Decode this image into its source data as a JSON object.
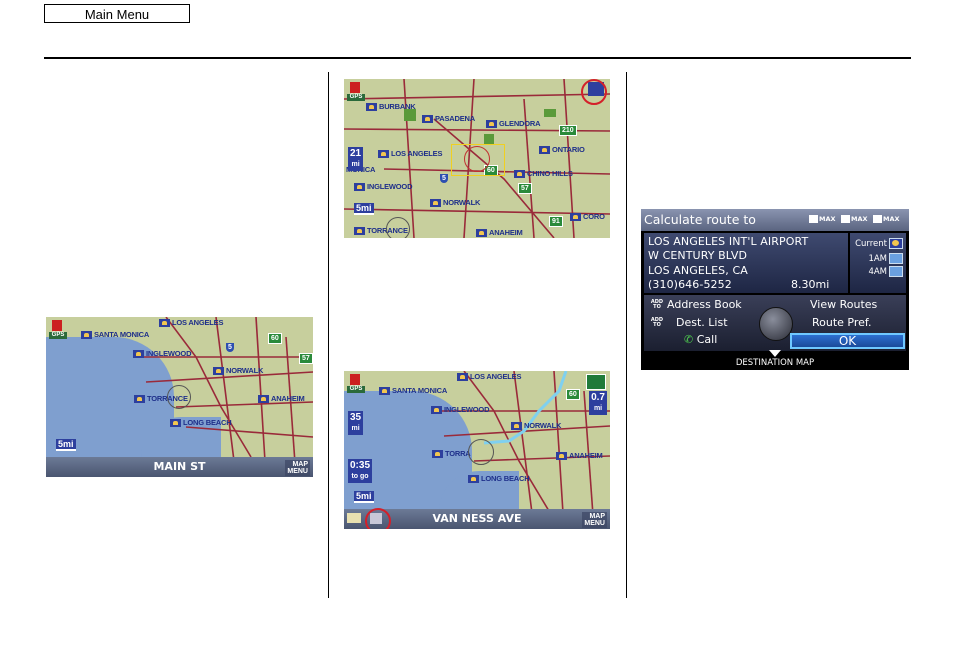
{
  "header": {
    "main_menu_label": "Main Menu"
  },
  "map1": {
    "cities": [
      "LOS ANGELES",
      "SANTA MONICA",
      "INGLEWOOD",
      "NORWALK",
      "TORRANCE",
      "ANAHEIM",
      "LONG BEACH"
    ],
    "highways": [
      "60",
      "57"
    ],
    "interstates": [
      "5"
    ],
    "scale": "5mi",
    "street": "MAIN ST",
    "map_menu": [
      "MAP",
      "MENU"
    ]
  },
  "map2": {
    "cities": [
      "BURBANK",
      "PASADENA",
      "GLENDORA",
      "LOS ANGELES",
      "ONTARIO",
      "CHINO HILLS",
      "INGLEWOOD",
      "NORWALK",
      "TORRANCE",
      "ANAHEIM",
      "CORO"
    ],
    "highways": [
      "210",
      "60",
      "57",
      "91"
    ],
    "interstates": [
      "5"
    ],
    "scale": "5mi",
    "distance_value": "21",
    "distance_unit": "mi",
    "monica_label": "MONICA"
  },
  "map3": {
    "cities": [
      "LOS ANGELES",
      "SANTA MONICA",
      "INGLEWOOD",
      "NORWALK",
      "TORRA",
      "ANAHEIM",
      "LONG BEACH"
    ],
    "highways": [
      "60"
    ],
    "scale": "5mi",
    "distance_value": "35",
    "distance_unit": "mi",
    "time_value": "0:35",
    "time_unit": "to go",
    "turn_distance": "0.7",
    "turn_unit": "mi",
    "street": "VAN NESS AVE",
    "map_menu": [
      "MAP",
      "MENU"
    ]
  },
  "dialog": {
    "title": "Calculate route to",
    "max_labels": [
      "MAX",
      "MAX",
      "MAX"
    ],
    "place_name": "LOS ANGELES INT'L AIRPORT",
    "street": "W CENTURY BLVD",
    "city": "LOS ANGELES, CA",
    "phone": "(310)646-5252",
    "distance": "8.30mi",
    "weather": [
      "Current",
      "1AM",
      "4AM"
    ],
    "add_to": "ADD TO",
    "address_book": "Address Book",
    "dest_list": "Dest. List",
    "call": "Call",
    "view_routes": "View Routes",
    "route_pref": "Route Pref.",
    "ok": "OK",
    "footer": "DESTINATION MAP"
  },
  "colors": {
    "sea": "#7f9fcf",
    "land": "#c7cf9d",
    "highlight": "#d4202a"
  }
}
